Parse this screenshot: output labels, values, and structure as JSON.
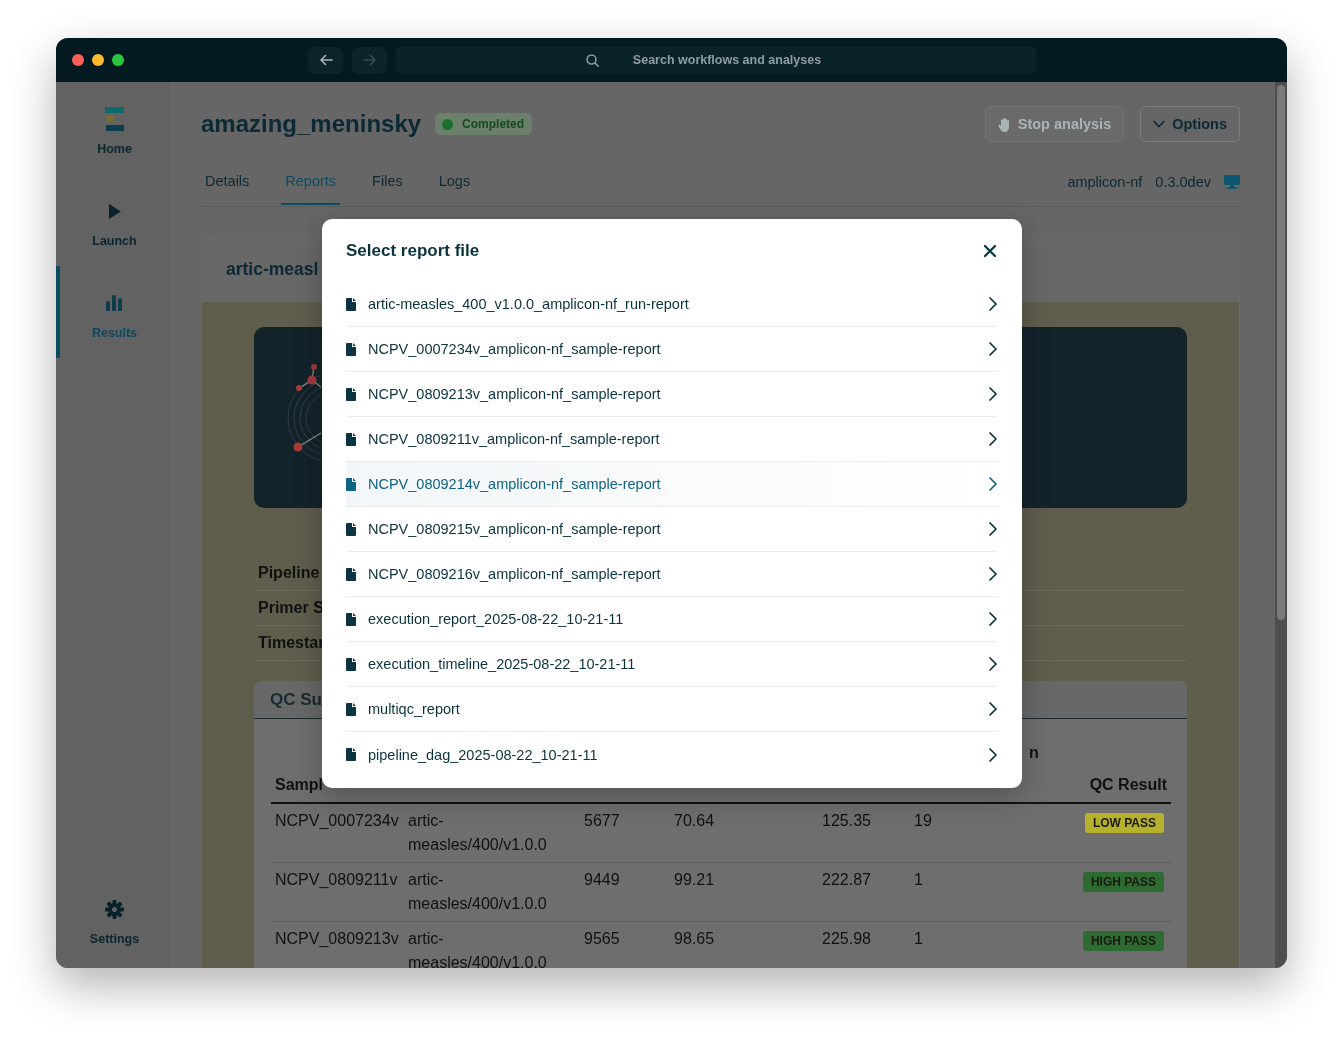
{
  "window": {
    "nav_buttons": [
      {
        "kind": "back",
        "disabled": false
      },
      {
        "kind": "forward",
        "disabled": true
      }
    ],
    "search": {
      "placeholder": "Search workflows and analyses"
    }
  },
  "sidebar": {
    "items": [
      {
        "kind": "home",
        "label": "Home",
        "selected": false
      },
      {
        "kind": "launch",
        "label": "Launch",
        "selected": false
      },
      {
        "kind": "results",
        "label": "Results",
        "selected": true
      }
    ],
    "footer_items": [
      {
        "kind": "settings",
        "label": "Settings",
        "selected": false
      }
    ]
  },
  "run": {
    "title": "amazing_meninsky",
    "status": "Completed",
    "actions": [
      {
        "kind": "stop",
        "label": "Stop analysis",
        "disabled": true
      },
      {
        "kind": "options",
        "label": "Options",
        "disabled": false
      }
    ],
    "tabs": [
      {
        "label": "Details",
        "selected": false
      },
      {
        "label": "Reports",
        "selected": true
      },
      {
        "label": "Files",
        "selected": false
      },
      {
        "label": "Logs",
        "selected": false
      }
    ],
    "pipeline": "amplicon-nf",
    "version": "0.3.0dev"
  },
  "report": {
    "title": "artic-measl",
    "info_rows": [
      "Pipeline",
      "Primer S",
      "Timestar"
    ],
    "qc_summary": {
      "title": "QC Su",
      "header_fragment": "n",
      "columns": {
        "sample": "Sampl",
        "qc_result": "QC Result"
      },
      "rows": [
        {
          "sample": "NCPV_0007234v",
          "column_2": "artic-measles/400/v1.0.0",
          "column_3": "5677",
          "column_4": "70.64",
          "column_5": "125.35",
          "column_6": "19",
          "qc_result": {
            "label": "LOW PASS",
            "color": "#b5b12c"
          }
        },
        {
          "sample": "NCPV_0809211v",
          "column_2": "artic-measles/400/v1.0.0",
          "column_3": "9449",
          "column_4": "99.21",
          "column_5": "222.87",
          "column_6": "1",
          "qc_result": {
            "label": "HIGH PASS",
            "color": "#2e6b33"
          }
        },
        {
          "sample": "NCPV_0809213v",
          "column_2": "artic-measles/400/v1.0.0",
          "column_3": "9565",
          "column_4": "98.65",
          "column_5": "225.98",
          "column_6": "1",
          "qc_result": {
            "label": "HIGH PASS",
            "color": "#2e6b33"
          }
        }
      ]
    }
  },
  "modal": {
    "title": "Select report file",
    "items": [
      {
        "label": "artic-measles_400_v1.0.0_amplicon-nf_run-report",
        "hovered": false
      },
      {
        "label": "NCPV_0007234v_amplicon-nf_sample-report",
        "hovered": false
      },
      {
        "label": "NCPV_0809213v_amplicon-nf_sample-report",
        "hovered": false
      },
      {
        "label": "NCPV_0809211v_amplicon-nf_sample-report",
        "hovered": false
      },
      {
        "label": "NCPV_0809214v_amplicon-nf_sample-report",
        "hovered": true
      },
      {
        "label": "NCPV_0809215v_amplicon-nf_sample-report",
        "hovered": false
      },
      {
        "label": "NCPV_0809216v_amplicon-nf_sample-report",
        "hovered": false
      },
      {
        "label": "execution_report_2025-08-22_10-21-11",
        "hovered": false
      },
      {
        "label": "execution_timeline_2025-08-22_10-21-11",
        "hovered": false
      },
      {
        "label": "multiqc_report",
        "hovered": false
      },
      {
        "label": "pipeline_dag_2025-08-22_10-21-11",
        "hovered": false
      }
    ]
  }
}
